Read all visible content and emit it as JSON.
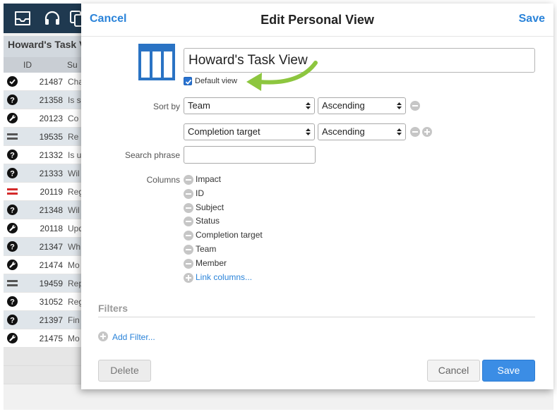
{
  "background": {
    "list_title": "Howard's Task View",
    "header": {
      "id": "ID",
      "subject": "Su"
    },
    "rows": [
      {
        "icon": "check-circle-icon",
        "id": "21487",
        "subject": "Cha"
      },
      {
        "icon": "question-circle-icon",
        "id": "21358",
        "subject": "Is s"
      },
      {
        "icon": "wrench-circle-icon",
        "id": "20123",
        "subject": "Co"
      },
      {
        "icon": "lines-icon",
        "id": "19535",
        "subject": "Re"
      },
      {
        "icon": "question-circle-icon",
        "id": "21332",
        "subject": "Is u"
      },
      {
        "icon": "question-circle-icon",
        "id": "21333",
        "subject": "Wil"
      },
      {
        "icon": "red-lines-icon",
        "id": "20119",
        "subject": "Reg"
      },
      {
        "icon": "question-circle-icon",
        "id": "21348",
        "subject": "Wil"
      },
      {
        "icon": "wrench-circle-icon",
        "id": "20118",
        "subject": "Upd"
      },
      {
        "icon": "question-circle-icon",
        "id": "21347",
        "subject": "Wh"
      },
      {
        "icon": "wrench-circle-icon",
        "id": "21474",
        "subject": "Mo"
      },
      {
        "icon": "lines-icon",
        "id": "19459",
        "subject": "Rep"
      },
      {
        "icon": "question-circle-icon",
        "id": "31052",
        "subject": "Reg"
      },
      {
        "icon": "question-circle-icon",
        "id": "21397",
        "subject": "Fin"
      },
      {
        "icon": "wrench-circle-icon",
        "id": "21475",
        "subject": "Mo"
      }
    ]
  },
  "modal": {
    "cancel_label": "Cancel",
    "title": "Edit Personal View",
    "save_label": "Save",
    "view_name": "Howard's Task View",
    "default_view_label": "Default view",
    "default_view_checked": true,
    "sort_by_label": "Sort by",
    "sorts": [
      {
        "field": "Team",
        "direction": "Ascending"
      },
      {
        "field": "Completion target",
        "direction": "Ascending"
      }
    ],
    "search_phrase_label": "Search phrase",
    "search_phrase_value": "",
    "columns_label": "Columns",
    "columns": [
      "Impact",
      "ID",
      "Subject",
      "Status",
      "Completion target",
      "Team",
      "Member"
    ],
    "link_columns_label": "Link columns...",
    "filters_heading": "Filters",
    "add_filter_label": "Add Filter...",
    "delete_label": "Delete",
    "footer_cancel_label": "Cancel",
    "footer_save_label": "Save"
  },
  "colors": {
    "accent": "#2a83d9",
    "primary_button": "#3b8de5",
    "arrow": "#8dc63f",
    "icon_blue": "#2a73c4",
    "topbar": "#1f3950"
  }
}
